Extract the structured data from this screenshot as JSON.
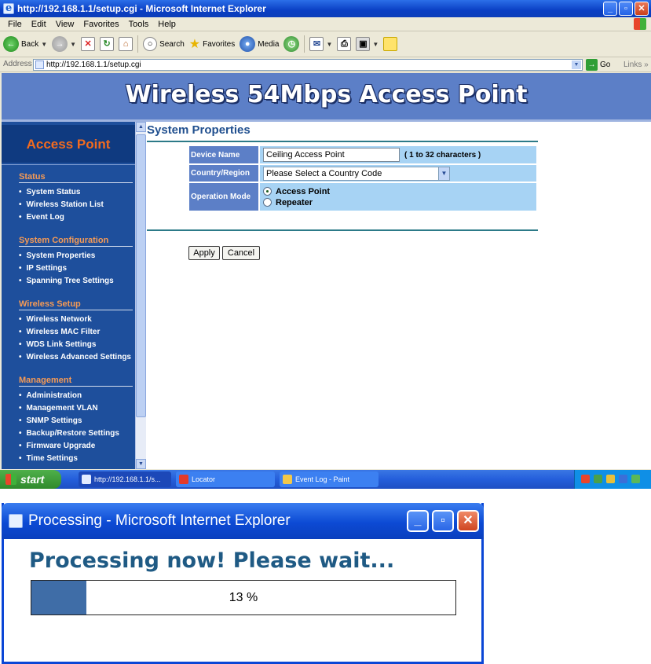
{
  "ie": {
    "title": "http://192.168.1.1/setup.cgi - Microsoft Internet Explorer",
    "menu": [
      "File",
      "Edit",
      "View",
      "Favorites",
      "Tools",
      "Help"
    ],
    "toolbar": {
      "back": "Back",
      "search": "Search",
      "favorites": "Favorites",
      "media": "Media"
    },
    "address_label": "Address",
    "address_url": "http://192.168.1.1/setup.cgi",
    "go_label": "Go",
    "links_label": "Links"
  },
  "page": {
    "banner_title": "Wireless 54Mbps Access Point",
    "sidebar_header": "Access Point",
    "sections": [
      {
        "title": "Status",
        "items": [
          "System Status",
          "Wireless Station List",
          "Event Log"
        ]
      },
      {
        "title": "System Configuration",
        "items": [
          "System Properties",
          "IP Settings",
          "Spanning Tree Settings"
        ]
      },
      {
        "title": "Wireless Setup",
        "items": [
          "Wireless Network",
          "Wireless MAC Filter",
          "WDS Link Settings",
          "Wireless Advanced Settings"
        ]
      },
      {
        "title": "Management",
        "items": [
          "Administration",
          "Management VLAN",
          "SNMP Settings",
          "Backup/Restore Settings",
          "Firmware Upgrade",
          "Time Settings"
        ]
      }
    ],
    "content_title": "System Properties",
    "form": {
      "device_name_label": "Device Name",
      "device_name_value": "Ceiling Access Point",
      "device_name_hint": "( 1 to 32 characters )",
      "country_label": "Country/Region",
      "country_value": "Please Select a Country Code",
      "operation_label": "Operation Mode",
      "mode_access_point": "Access Point",
      "mode_repeater": "Repeater",
      "selected_mode": "Access Point"
    },
    "apply_label": "Apply",
    "cancel_label": "Cancel"
  },
  "taskbar": {
    "start_label": "start",
    "tasks": [
      "http://192.168.1.1/s...",
      "Locator",
      "Event Log - Paint"
    ]
  },
  "dialog": {
    "title": "Processing - Microsoft Internet Explorer",
    "heading": "Processing now! Please wait...",
    "progress_percent": 13,
    "progress_text": "13 %"
  },
  "colors": {
    "banner": "#5c7fc7",
    "sidebar": "#1e4f9c",
    "sidebar_header_text": "#f26b1f",
    "section_title": "#f59a55",
    "content_title": "#21508f",
    "form_label_bg": "#5c7fc7",
    "form_value_bg": "#a7d3f4",
    "rule": "#2c7a88",
    "progress_fill": "#3f6da7",
    "dialog_heading": "#1f5a84"
  }
}
